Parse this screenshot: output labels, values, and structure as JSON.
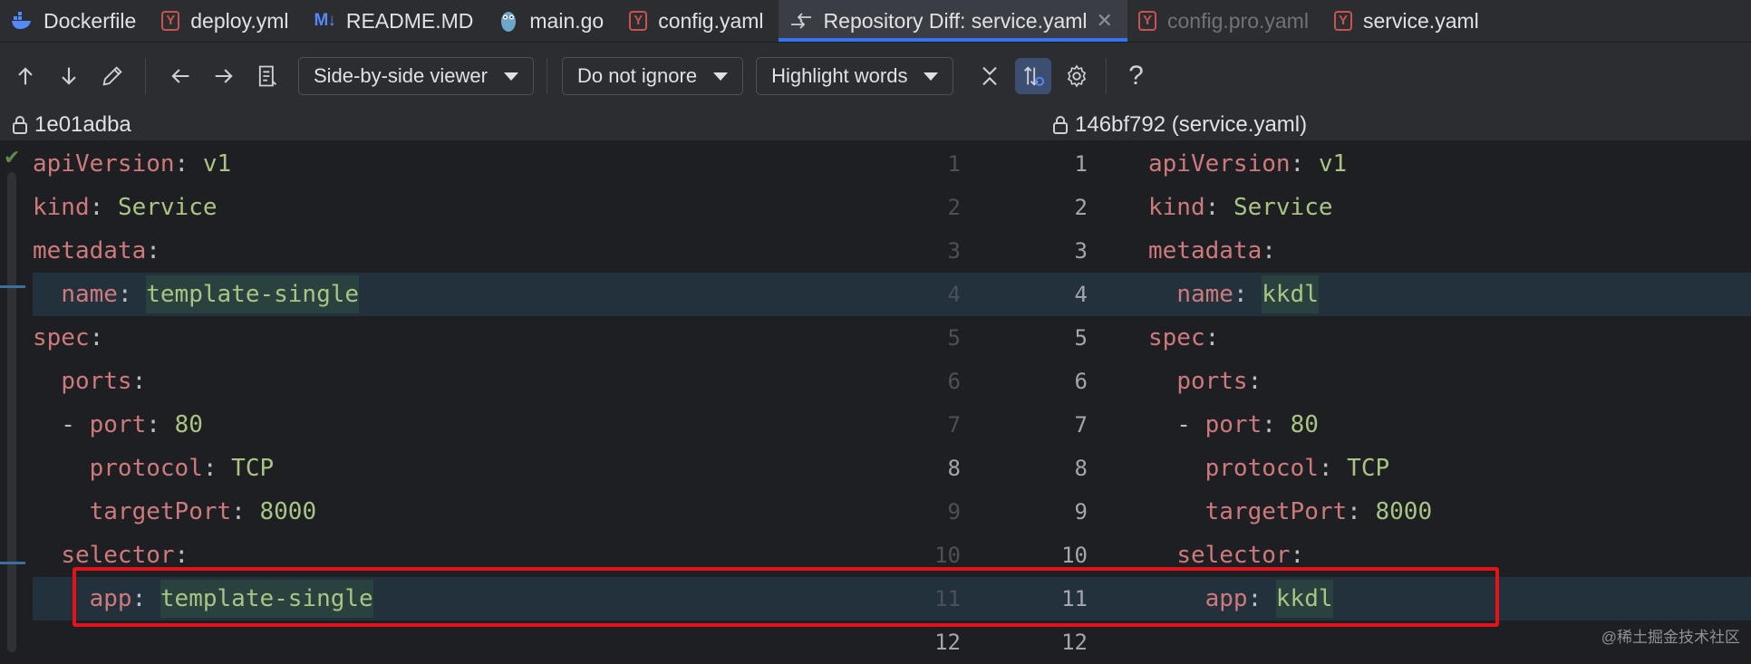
{
  "tabs": [
    {
      "label": "Dockerfile",
      "icon": "docker-icon",
      "state": "normal"
    },
    {
      "label": "deploy.yml",
      "icon": "yaml-icon",
      "state": "normal"
    },
    {
      "label": "README.MD",
      "icon": "markdown-icon",
      "state": "normal"
    },
    {
      "label": "main.go",
      "icon": "go-gopher-icon",
      "state": "normal"
    },
    {
      "label": "config.yaml",
      "icon": "yaml-icon",
      "state": "normal"
    },
    {
      "label": "Repository Diff: service.yaml",
      "icon": "diff-icon",
      "state": "active",
      "close": "✕"
    },
    {
      "label": "config.pro.yaml",
      "icon": "yaml-icon",
      "state": "dim"
    },
    {
      "label": "service.yaml",
      "icon": "yaml-icon",
      "state": "normal"
    }
  ],
  "toolbar": {
    "viewer_mode": "Side-by-side viewer",
    "ignore_mode": "Do not ignore",
    "highlight_mode": "Highlight words",
    "help": "?"
  },
  "left_revision": "1e01adba",
  "right_revision": "146bf792 (service.yaml)",
  "left_lines": [
    [
      [
        "k",
        "apiVersion"
      ],
      [
        "p",
        ": "
      ],
      [
        "v",
        "v1"
      ]
    ],
    [
      [
        "k",
        "kind"
      ],
      [
        "p",
        ": "
      ],
      [
        "v",
        "Service"
      ]
    ],
    [
      [
        "k",
        "metadata"
      ],
      [
        "p",
        ":"
      ]
    ],
    [
      [
        "p",
        "  "
      ],
      [
        "k",
        "name"
      ],
      [
        "p",
        ": "
      ],
      [
        "vh",
        "template-single"
      ]
    ],
    [
      [
        "k",
        "spec"
      ],
      [
        "p",
        ":"
      ]
    ],
    [
      [
        "p",
        "  "
      ],
      [
        "k",
        "ports"
      ],
      [
        "p",
        ":"
      ]
    ],
    [
      [
        "p",
        "  - "
      ],
      [
        "k",
        "port"
      ],
      [
        "p",
        ": "
      ],
      [
        "v",
        "80"
      ]
    ],
    [
      [
        "p",
        "    "
      ],
      [
        "k",
        "protocol"
      ],
      [
        "p",
        ": "
      ],
      [
        "v",
        "TCP"
      ]
    ],
    [
      [
        "p",
        "    "
      ],
      [
        "k",
        "targetPort"
      ],
      [
        "p",
        ": "
      ],
      [
        "v",
        "8000"
      ]
    ],
    [
      [
        "p",
        "  "
      ],
      [
        "k",
        "selector"
      ],
      [
        "p",
        ":"
      ]
    ],
    [
      [
        "p",
        "    "
      ],
      [
        "k",
        "app"
      ],
      [
        "p",
        ": "
      ],
      [
        "vh",
        "template-single"
      ]
    ]
  ],
  "right_lines": [
    [
      [
        "k",
        "apiVersion"
      ],
      [
        "p",
        ": "
      ],
      [
        "v",
        "v1"
      ]
    ],
    [
      [
        "k",
        "kind"
      ],
      [
        "p",
        ": "
      ],
      [
        "v",
        "Service"
      ]
    ],
    [
      [
        "k",
        "metadata"
      ],
      [
        "p",
        ":"
      ]
    ],
    [
      [
        "p",
        "  "
      ],
      [
        "k",
        "name"
      ],
      [
        "p",
        ": "
      ],
      [
        "vh",
        "kkdl"
      ]
    ],
    [
      [
        "k",
        "spec"
      ],
      [
        "p",
        ":"
      ]
    ],
    [
      [
        "p",
        "  "
      ],
      [
        "k",
        "ports"
      ],
      [
        "p",
        ":"
      ]
    ],
    [
      [
        "p",
        "  - "
      ],
      [
        "k",
        "port"
      ],
      [
        "p",
        ": "
      ],
      [
        "v",
        "80"
      ]
    ],
    [
      [
        "p",
        "    "
      ],
      [
        "k",
        "protocol"
      ],
      [
        "p",
        ": "
      ],
      [
        "v",
        "TCP"
      ]
    ],
    [
      [
        "p",
        "    "
      ],
      [
        "k",
        "targetPort"
      ],
      [
        "p",
        ": "
      ],
      [
        "v",
        "8000"
      ]
    ],
    [
      [
        "p",
        "  "
      ],
      [
        "k",
        "selector"
      ],
      [
        "p",
        ":"
      ]
    ],
    [
      [
        "p",
        "    "
      ],
      [
        "k",
        "app"
      ],
      [
        "p",
        ": "
      ],
      [
        "vh",
        "kkdl"
      ]
    ]
  ],
  "changed_lines": [
    4,
    11
  ],
  "line_numbers": [
    "1",
    "2",
    "3",
    "4",
    "5",
    "6",
    "7",
    "8",
    "9",
    "10",
    "11",
    "12"
  ],
  "watermark": "@稀土掘金技术社区",
  "colors": {
    "accent": "#3574f0",
    "highlight_box": "#e3131b",
    "key": "#cf8e6d",
    "value": "#a9c483"
  }
}
